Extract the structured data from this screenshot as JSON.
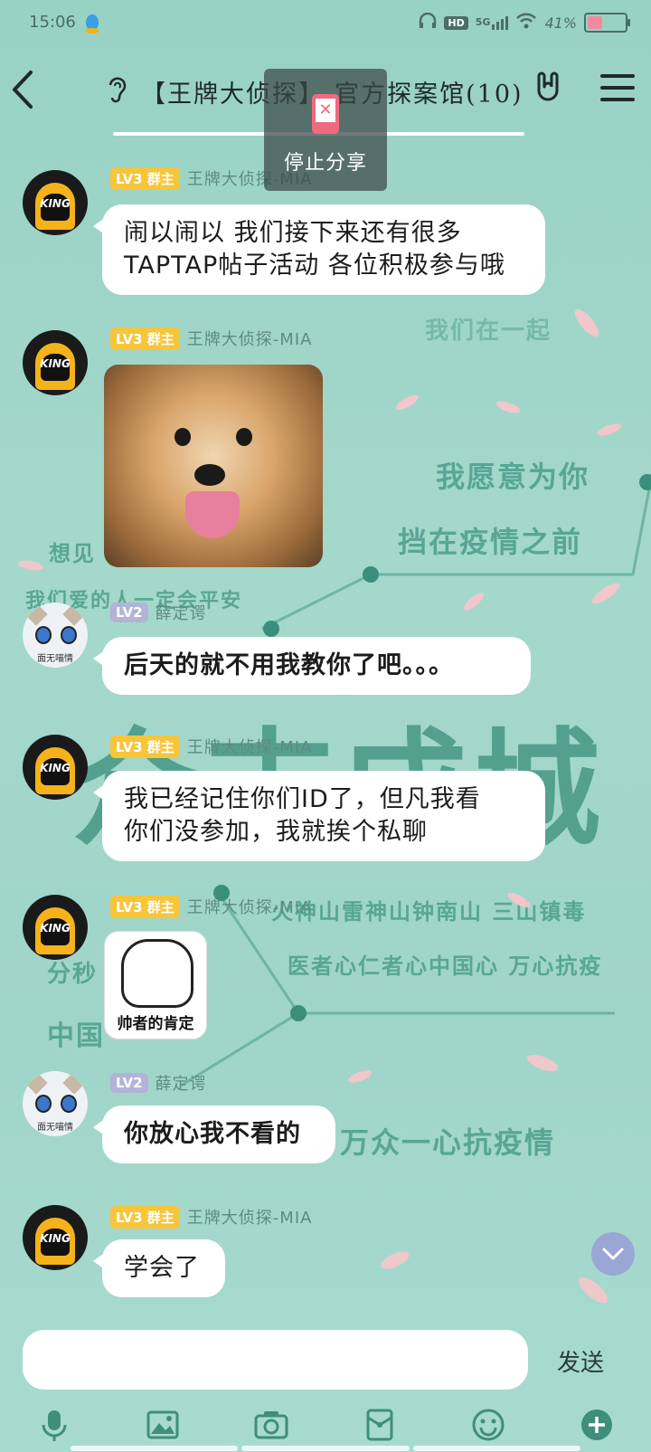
{
  "status_bar": {
    "time": "15:06",
    "network": "5G",
    "hd": "HD",
    "battery_text": "41%",
    "battery_level": 0.41
  },
  "header": {
    "title": "【王牌大侦探】-官方探案馆(10)",
    "back_icon": "back-chevron-icon",
    "ear_icon": "ear-icon",
    "hand_icon": "rock-hand-icon",
    "menu_icon": "menu-icon"
  },
  "share_overlay": {
    "label": "停止分享",
    "icon": "phone-stop-icon"
  },
  "background": {
    "lines": [
      "我们在一起",
      "我愿意为你",
      "挡在疫情之前",
      "想见",
      "我们爱的人一定会平安",
      "众志成城",
      "火神山雷神山钟南山 三山镇毒",
      "医者心仁者心中国心 万心抗疫",
      "分秒",
      "中国",
      "万众一心抗疫情"
    ]
  },
  "messages": [
    {
      "level": "LV3",
      "role": "群主",
      "sender": "王牌大侦探-MIA",
      "type": "text",
      "text_lines": [
        "闹以闹以 我们接下来还有很多",
        "TAPTAP帖子活动 各位积极参与哦"
      ]
    },
    {
      "level": "LV3",
      "role": "群主",
      "sender": "王牌大侦探-MIA",
      "type": "image"
    },
    {
      "level": "LV2",
      "role": "",
      "sender": "薛定谔",
      "avatar_caption": "面无喵情",
      "type": "text",
      "text_lines": [
        "后天的就不用我教你了吧。。。"
      ]
    },
    {
      "level": "LV3",
      "role": "群主",
      "sender": "王牌大侦探-MIA",
      "type": "text",
      "text_lines": [
        "我已经记住你们ID了，但凡我看",
        "你们没参加，我就挨个私聊"
      ]
    },
    {
      "level": "LV3",
      "role": "群主",
      "sender": "王牌大侦探-MIA",
      "type": "sticker",
      "caption": "帅者的肯定"
    },
    {
      "level": "LV2",
      "role": "",
      "sender": "薛定谔",
      "avatar_caption": "面无喵情",
      "type": "text",
      "text_lines": [
        "你放心我不看的"
      ]
    },
    {
      "level": "LV3",
      "role": "群主",
      "sender": "王牌大侦探-MIA",
      "type": "text",
      "text_lines": [
        "学会了"
      ]
    }
  ],
  "input": {
    "value": "",
    "placeholder": "",
    "send_label": "发送"
  },
  "toolbar": {
    "icons": [
      "microphone-icon",
      "image-icon",
      "camera-icon",
      "red-packet-icon",
      "emoji-icon",
      "plus-icon"
    ]
  },
  "colors": {
    "background": "#9fd6c9",
    "owner_badge": "#f7c53a",
    "member_badge": "#b2b3d6",
    "bubble": "#ffffff"
  }
}
